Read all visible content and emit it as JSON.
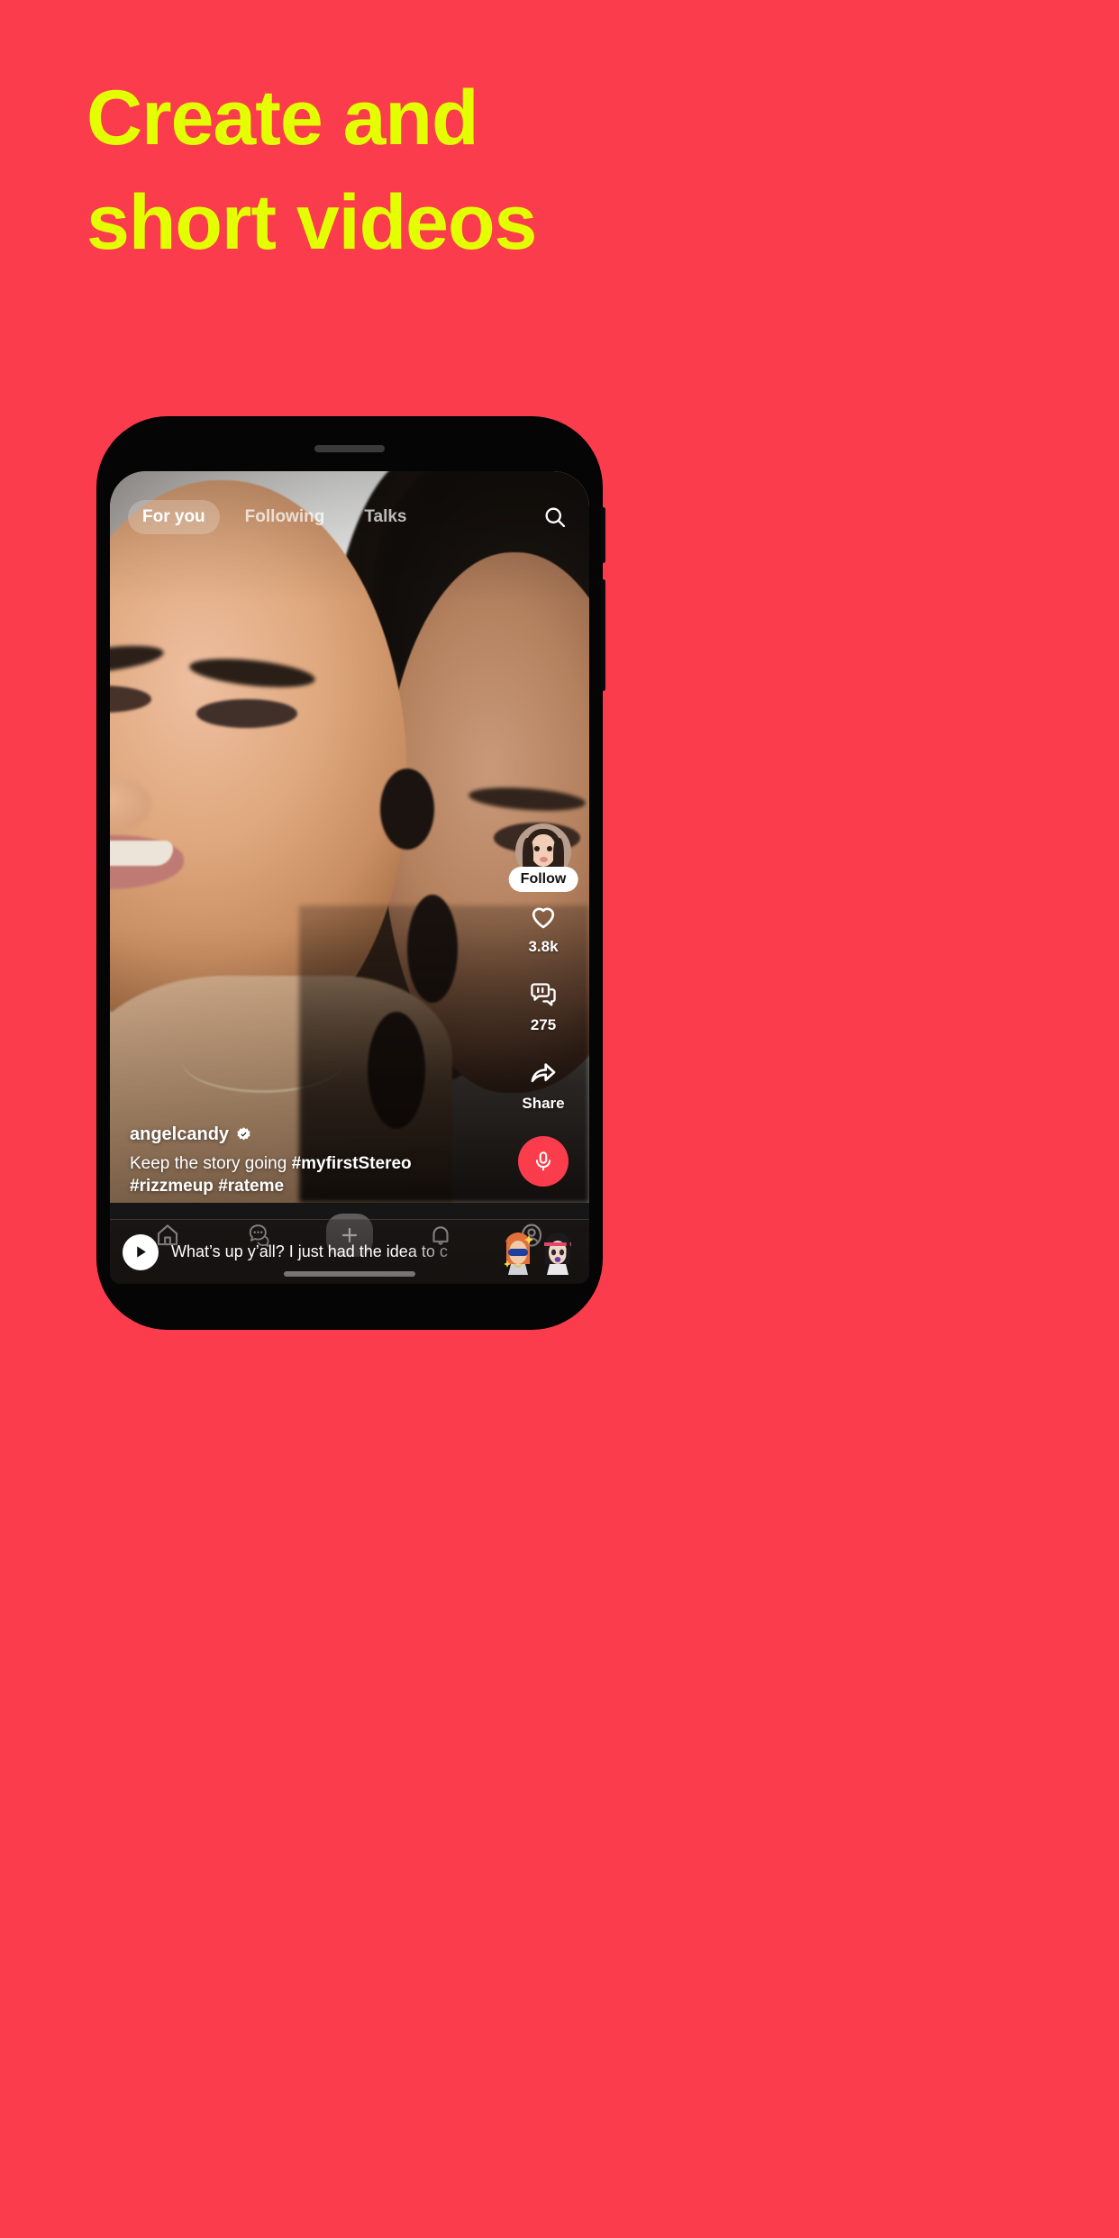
{
  "page": {
    "background_color": "#FA3C4C",
    "accent_color": "#E4FF00"
  },
  "headline": {
    "line1": "Create and",
    "line2": "short videos"
  },
  "phone": {
    "screen": {
      "top_tabs": [
        {
          "label": "For you",
          "active": true
        },
        {
          "label": "Following",
          "active": false
        },
        {
          "label": "Talks",
          "active": false
        }
      ],
      "search_icon": "search-icon",
      "action_rail": {
        "avatar_icon": "avatar-bitmoji-icon",
        "follow_label": "Follow",
        "like": {
          "icon": "heart-icon",
          "count": "3.8k"
        },
        "comment": {
          "icon": "comment-bubbles-icon",
          "count": "275"
        },
        "share": {
          "icon": "share-arrow-icon",
          "label": "Share"
        },
        "mic": {
          "icon": "microphone-icon",
          "color": "#FA3C4C"
        }
      },
      "caption": {
        "username": "angelcandy",
        "verified_icon": "verified-badge-icon",
        "text_plain": "Keep the story going ",
        "hashtags": "#myfirstStereo #rizzmeup #rateme"
      },
      "audio_bar": {
        "play_icon": "play-icon",
        "text": "What’s up y’all? I just had the idea to c",
        "avatars": [
          "bitmoji-orange-hair-sunglasses",
          "bitmoji-dark-hair-headband"
        ]
      },
      "bottom_nav": [
        {
          "name": "home",
          "icon": "home-icon"
        },
        {
          "name": "chats",
          "icon": "chat-bubbles-icon"
        },
        {
          "name": "create",
          "icon": "plus-icon"
        },
        {
          "name": "notifications",
          "icon": "bell-icon"
        },
        {
          "name": "profile",
          "icon": "profile-icon"
        }
      ]
    }
  }
}
